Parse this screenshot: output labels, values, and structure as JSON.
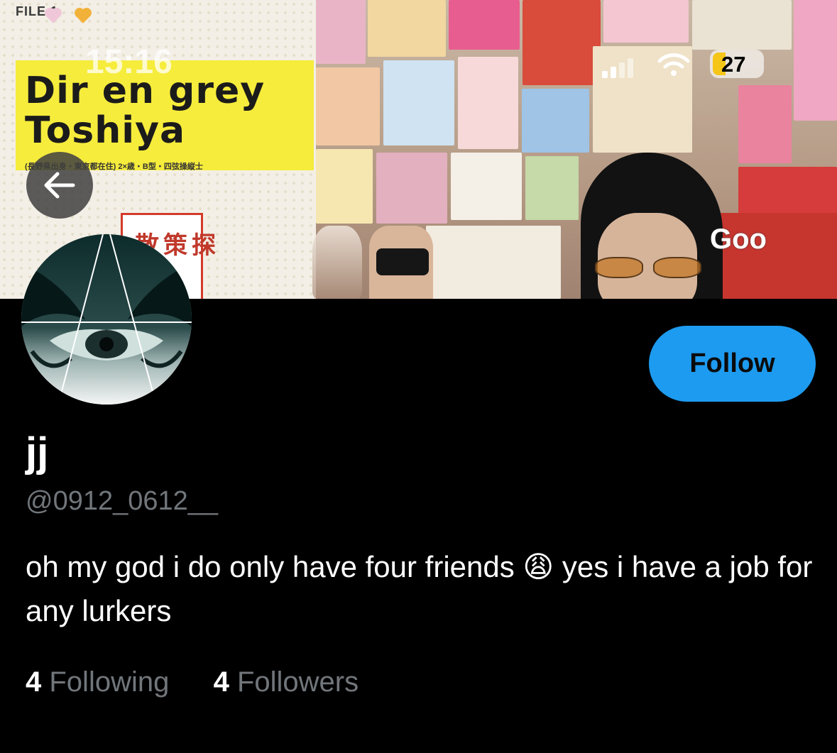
{
  "banner": {
    "file_label": "FILE.1",
    "status_time": "15:16",
    "artist_title": "Dir en grey\nToshiya",
    "caption": "(長野県出身・東京都在住) 2×歳・B型・四弦操縦士",
    "sign_text": "散策探",
    "store_sign": "Goo",
    "battery_level": "27",
    "accent_yellow": "#f6ec3c"
  },
  "nav": {
    "back_icon": "arrow-left-icon"
  },
  "profile": {
    "display_name": "jj",
    "handle": "@0912_0612__",
    "bio": "oh my god i do only have four friends 😩  yes i have a job for any lurkers",
    "follow_label": "Follow",
    "following_count": "4",
    "following_label": "Following",
    "followers_count": "4",
    "followers_label": "Followers"
  },
  "colors": {
    "background": "#000000",
    "follow_button": "#1d9bf0",
    "secondary_text": "#71767b",
    "primary_text": "#ffffff"
  }
}
